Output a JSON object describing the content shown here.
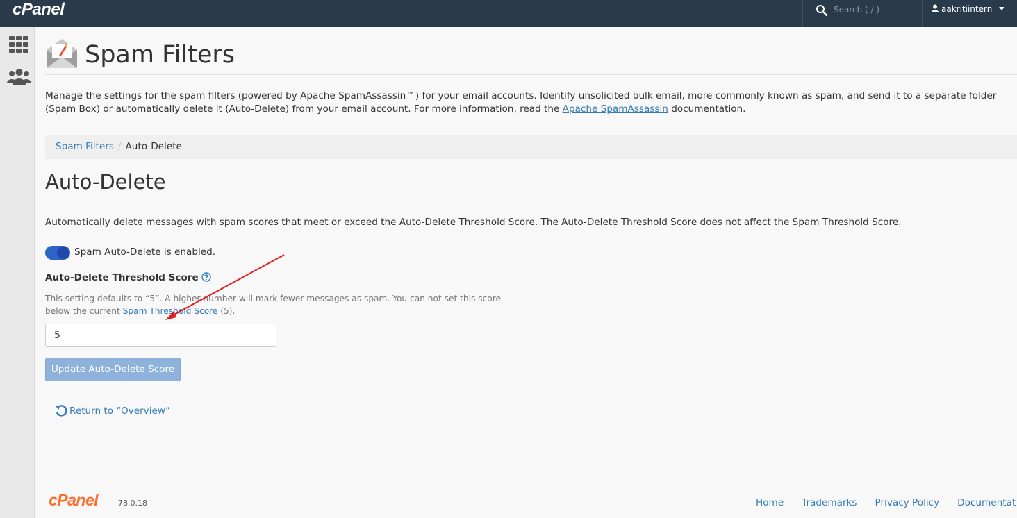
{
  "topbar": {
    "brand": "cPanel",
    "search_placeholder": "Search ( / )",
    "username": "aakritiintern"
  },
  "sidebar": {
    "items": [
      {
        "icon": "grid-icon"
      },
      {
        "icon": "users-icon"
      }
    ]
  },
  "page": {
    "title": "Spam Filters",
    "intro_before": "Manage the settings for the spam filters (powered by Apache SpamAssassin™) for your email accounts. Identify unsolicited bulk email, more commonly known as spam, and send it to a separate folder (Spam Box) or automatically delete it (Auto-Delete) from your email account. For more information, read the ",
    "intro_link": "Apache SpamAssassin",
    "intro_after": " documentation."
  },
  "breadcrumb": {
    "parent": "Spam Filters",
    "separator": "/",
    "current": "Auto-Delete"
  },
  "section": {
    "title": "Auto-Delete",
    "description": "Automatically delete messages with spam scores that meet or exceed the Auto-Delete Threshold Score. The Auto-Delete Threshold Score does not affect the Spam Threshold Score.",
    "toggle_label": "Spam Auto-Delete is enabled.",
    "toggle_on": true,
    "field_label": "Auto-Delete Threshold Score",
    "hint_before": "This setting defaults to “5”. A higher number will mark fewer messages as spam. You can not set this score below the current ",
    "hint_link": "Spam Threshold Score",
    "hint_after": " (5).",
    "score_value": "5",
    "update_button": "Update Auto-Delete Score",
    "return_link": "Return to “Overview”"
  },
  "footer": {
    "logo": "cPanel",
    "version": "78.0.18",
    "links": [
      "Home",
      "Trademarks",
      "Privacy Policy",
      "Documentat"
    ]
  },
  "colors": {
    "topbar": "#293a4a",
    "link": "#337ab7",
    "toggle": "#2c64c7",
    "button": "#8eb2dc",
    "footer_logo": "#ff6c2c",
    "annotation_arrow": "#e02020"
  }
}
